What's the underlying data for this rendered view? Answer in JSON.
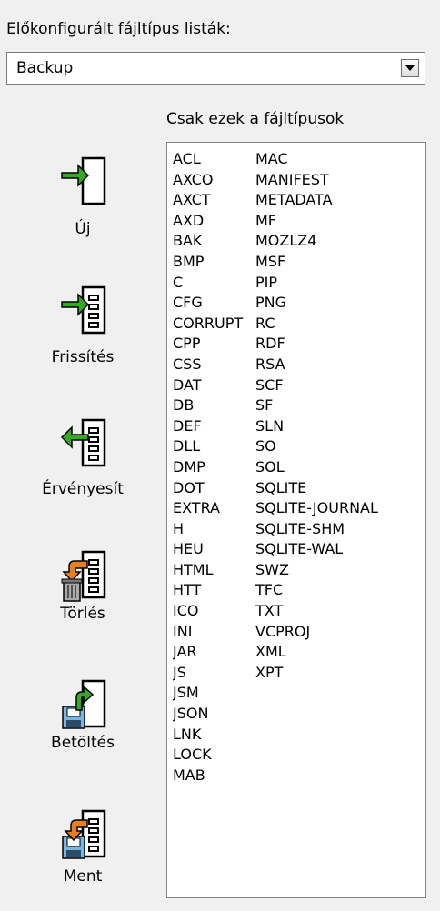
{
  "preset": {
    "label": "Előkonfigurált fájltípus listák:",
    "selected": "Backup"
  },
  "list": {
    "caption": "Csak ezek a fájltípusok",
    "column1": [
      "ACL",
      "AXCO",
      "AXCT",
      "AXD",
      "BAK",
      "BMP",
      "C",
      "CFG",
      "CORRUPT",
      "CPP",
      "CSS",
      "DAT",
      "DB",
      "DEF",
      "DLL",
      "DMP",
      "DOT",
      "EXTRA",
      "H",
      "HEU",
      "HTML",
      "HTT",
      "ICO",
      "INI",
      "JAR",
      "JS",
      "JSM",
      "JSON",
      "LNK",
      "LOCK",
      "MAB"
    ],
    "column2": [
      "MAC",
      "MANIFEST",
      "METADATA",
      "MF",
      "MOZLZ4",
      "MSF",
      "PIP",
      "PNG",
      "RC",
      "RDF",
      "RSA",
      "SCF",
      "SF",
      "SLN",
      "SO",
      "SOL",
      "SQLITE",
      "SQLITE-JOURNAL",
      "SQLITE-SHM",
      "SQLITE-WAL",
      "SWZ",
      "TFC",
      "TXT",
      "VCPROJ",
      "XML",
      "XPT"
    ]
  },
  "buttons": {
    "new": "Új",
    "update": "Frissítés",
    "apply": "Érvényesít",
    "delete": "Törlés",
    "load": "Betöltés",
    "save": "Ment"
  },
  "colors": {
    "arrow_green": "#33aa22",
    "arrow_orange": "#e8801a",
    "disk_blue": "#7ab6e0"
  }
}
